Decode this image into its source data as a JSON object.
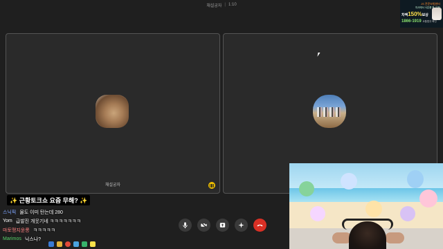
{
  "meeting": {
    "title": "채설궁자",
    "separator": "|",
    "timer": "1:10"
  },
  "tiles": {
    "left": {
      "name": "채설궁자",
      "avatar": "cat-photo-avatar",
      "speaking": true
    },
    "right": {
      "name": "",
      "avatar": "group-beach-photo-avatar"
    }
  },
  "ad": {
    "line1": "JS 전문보험센터",
    "line2": "지사에서 사은품 팍 크게!",
    "highlight": "차액",
    "percent": "150%",
    "suffix": "보상",
    "phone": "1866-1919",
    "phone_note": "교통법규 확인"
  },
  "banner": "✨ 근황토크쇼 요즘 무해? ✨",
  "chat": [
    {
      "user": "스닉픽",
      "user_color": "#7fa6ff",
      "message": "물도 이미 탄는데 280"
    },
    {
      "user": "Yom",
      "user_color": "#ffffff",
      "message": "급발진 개웃기네 ㅋㅋㅋㅋㅋㅋㅋ"
    },
    {
      "user": "마토맹지윤롱",
      "user_color": "#ff8080",
      "message": "ㅋㅋㅋㅋㅋ"
    },
    {
      "user": "Marimos",
      "user_color": "#58d36a",
      "message": "닉스나?"
    }
  ],
  "controls": [
    {
      "name": "mic-button",
      "icon": "mic-icon"
    },
    {
      "name": "camera-button",
      "icon": "camera-off-icon"
    },
    {
      "name": "share-screen-button",
      "icon": "share-screen-icon"
    },
    {
      "name": "effects-button",
      "icon": "sparkle-icon"
    },
    {
      "name": "end-call-button",
      "icon": "hang-up-icon"
    }
  ],
  "colors": {
    "background": "#1f1f1f",
    "tile": "#2a2a2a",
    "end_call": "#d93025",
    "speaking": "#f0c000"
  }
}
